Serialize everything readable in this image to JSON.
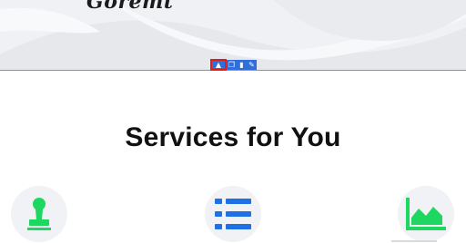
{
  "hero": {
    "signature_text": "Goremt"
  },
  "editor_toolbar": {
    "buttons": [
      {
        "icon": "mountain-icon",
        "glyph": "▲",
        "active": true
      },
      {
        "icon": "copy-icon",
        "glyph": "❐",
        "active": false
      },
      {
        "icon": "trash-icon",
        "glyph": "▮",
        "active": false
      },
      {
        "icon": "pencil-icon",
        "glyph": "✎",
        "active": false
      }
    ]
  },
  "services": {
    "title": "Services for You",
    "cards": [
      {
        "icon": "stamp-icon",
        "color": "#1ed760"
      },
      {
        "icon": "list-icon",
        "color": "#1f6fe5"
      },
      {
        "icon": "area-chart-icon",
        "color": "#1ed760"
      }
    ]
  },
  "colors": {
    "accent_blue": "#2f6fdc",
    "highlight_red": "#e21b1b",
    "green": "#1ed760",
    "blue": "#1f6fe5"
  }
}
